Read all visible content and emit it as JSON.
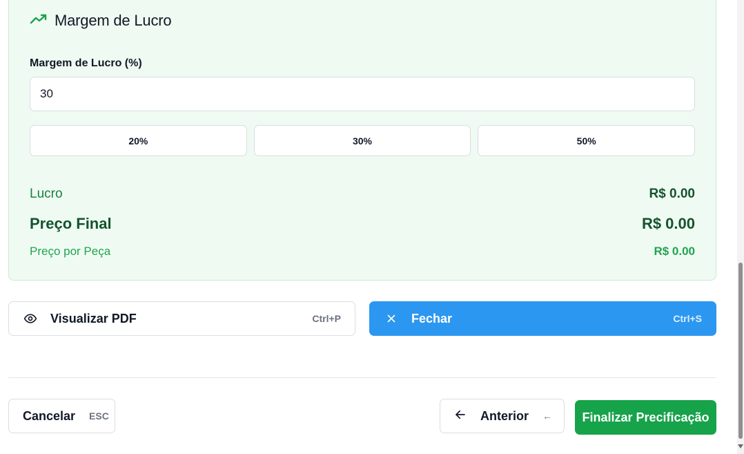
{
  "card": {
    "title": "Margem de Lucro",
    "icon": "trending-up-icon",
    "field_label": "Margem de Lucro (%)",
    "input_value": "30",
    "presets": [
      "20%",
      "30%",
      "50%"
    ],
    "lucro_label": "Lucro",
    "lucro_value": "R$ 0.00",
    "preco_final_label": "Preço Final",
    "preco_final_value": "R$ 0.00",
    "preco_peca_label": "Preço por Peça",
    "preco_peca_value": "R$ 0.00"
  },
  "actions": {
    "pdf_label": "Visualizar PDF",
    "pdf_shortcut": "Ctrl+P",
    "close_label": "Fechar",
    "close_shortcut": "Ctrl+S"
  },
  "footer": {
    "cancel_label": "Cancelar",
    "cancel_shortcut": "ESC",
    "prev_label": "Anterior",
    "prev_shortcut": "←",
    "finish_label": "Finalizar Precificação"
  },
  "colors": {
    "card_bg": "#effbf2",
    "accent_green": "#16a34a",
    "dark_green": "#14532d",
    "blue": "#2b97f0"
  }
}
